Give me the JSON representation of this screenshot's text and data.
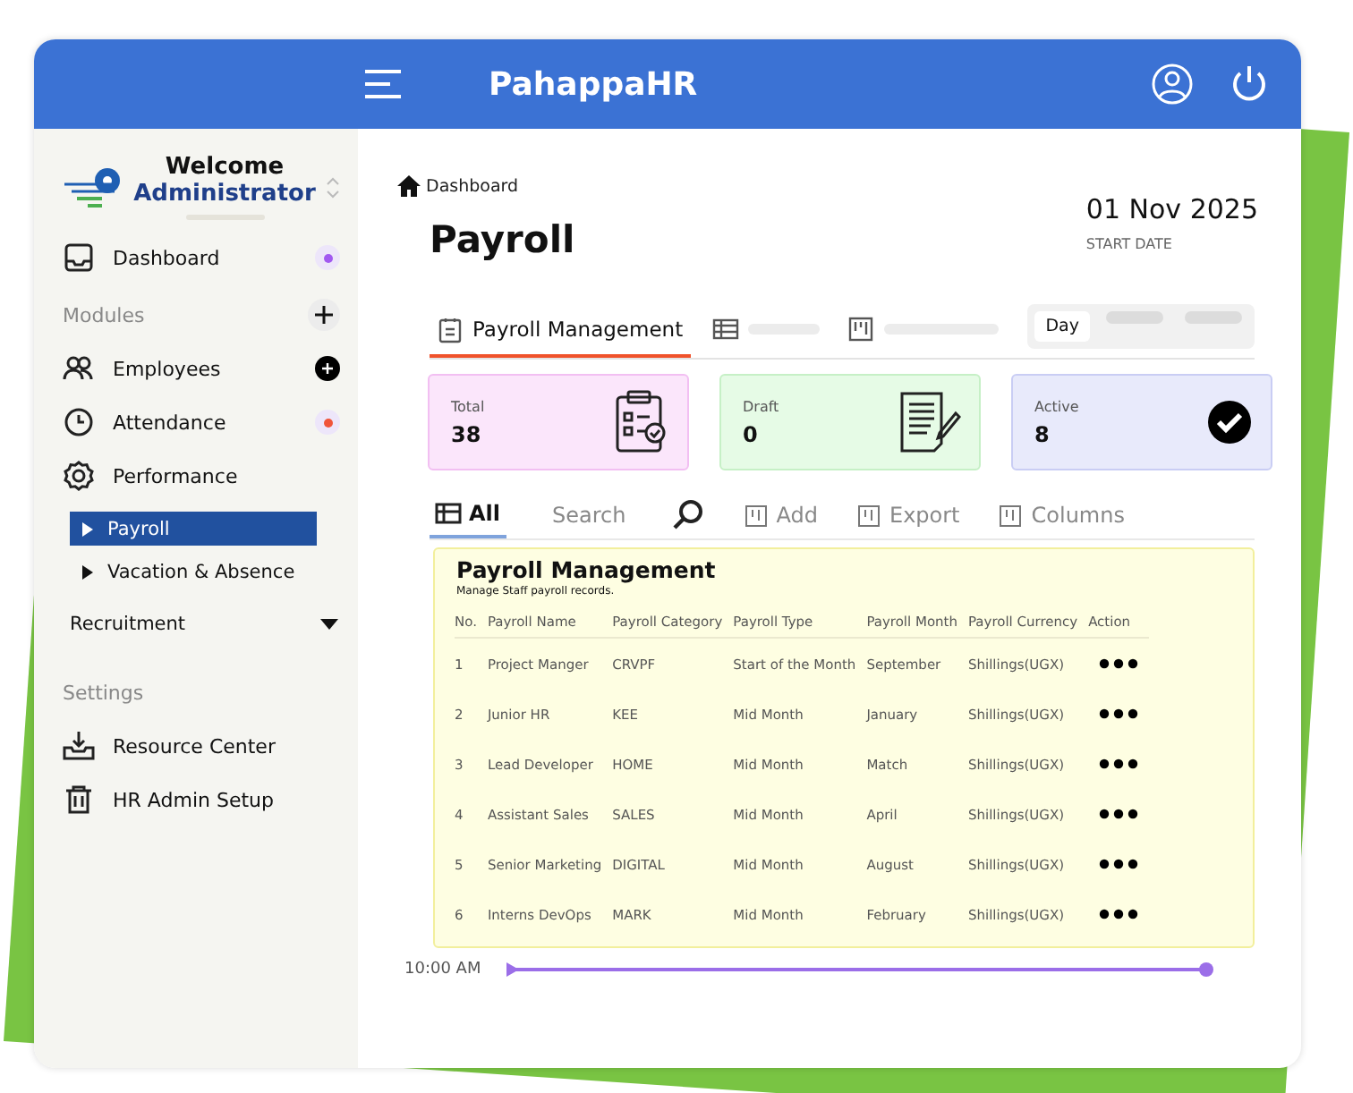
{
  "app": {
    "title": "PahappaHR"
  },
  "user": {
    "greeting": "Welcome",
    "role": "Administrator"
  },
  "sidebar": {
    "items": [
      {
        "kind": "link",
        "label": "Dashboard",
        "color": "#a259f0",
        "selected": false
      },
      {
        "kind": "header",
        "label": "Modules"
      },
      {
        "kind": "link",
        "label": "Employees",
        "selected": false
      },
      {
        "kind": "link",
        "label": "Attendance",
        "color": "#f0553a",
        "selected": false
      },
      {
        "kind": "link",
        "label": "Performance",
        "selected": false
      },
      {
        "kind": "sub",
        "label": "Payroll",
        "selected": true
      },
      {
        "kind": "sub",
        "label": "Vacation & Absence",
        "selected": false
      },
      {
        "kind": "dropdown",
        "label": "Recruitment",
        "expanded": false
      },
      {
        "kind": "header",
        "label": "Settings"
      },
      {
        "kind": "link",
        "label": "Resource Center",
        "selected": false
      },
      {
        "kind": "link",
        "label": "HR Admin Setup",
        "selected": false
      }
    ]
  },
  "breadcrumb": "Dashboard",
  "page_title": "Payroll",
  "date": {
    "value": "01 Nov 2025",
    "label": "START DATE"
  },
  "tabs": [
    {
      "label": "Payroll Management",
      "selected": true
    },
    {
      "selected": false
    },
    {
      "selected": false
    }
  ],
  "period": [
    {
      "label": "Day",
      "selected": true
    },
    {
      "selected": false
    },
    {
      "selected": false
    }
  ],
  "stats": [
    {
      "label": "Total",
      "value": "38",
      "color": "#fbe6fb"
    },
    {
      "label": "Draft",
      "value": "0",
      "color": "#e6fbe6"
    },
    {
      "label": "Active",
      "value": "8",
      "color": "#e8eafb"
    }
  ],
  "toolbar": [
    {
      "kind": "tab",
      "label": "All",
      "selected": true
    },
    {
      "kind": "text",
      "label": "Search"
    },
    {
      "kind": "search"
    },
    {
      "kind": "action",
      "label": "Add"
    },
    {
      "kind": "action",
      "label": "Export"
    },
    {
      "kind": "action",
      "label": "Columns"
    }
  ],
  "table": {
    "title": "Payroll Management",
    "subtitle": "Manage Staff payroll records.",
    "columns": [
      "No.",
      "Payroll Name",
      "Payroll Category",
      "Payroll Type",
      "Payroll Month",
      "Payroll Currency",
      "Action"
    ],
    "rows": [
      [
        "1",
        "Project Manger",
        "CRVPF",
        "Start of the Month",
        "September",
        "Shillings(UGX)"
      ],
      [
        "2",
        "Junior HR",
        "KEE",
        "Mid Month",
        "January",
        "Shillings(UGX)"
      ],
      [
        "3",
        "Lead Developer",
        "HOME",
        "Mid Month",
        "Match",
        "Shillings(UGX)"
      ],
      [
        "4",
        "Assistant Sales",
        "SALES",
        "Mid Month",
        "April",
        "Shillings(UGX)"
      ],
      [
        "5",
        "Senior Marketing",
        "DIGITAL",
        "Mid Month",
        "August",
        "Shillings(UGX)"
      ],
      [
        "6",
        "Interns  DevOps",
        "MARK",
        "Mid Month",
        "February",
        "Shillings(UGX)"
      ]
    ]
  },
  "timeline": {
    "time": "10:00 AM"
  }
}
